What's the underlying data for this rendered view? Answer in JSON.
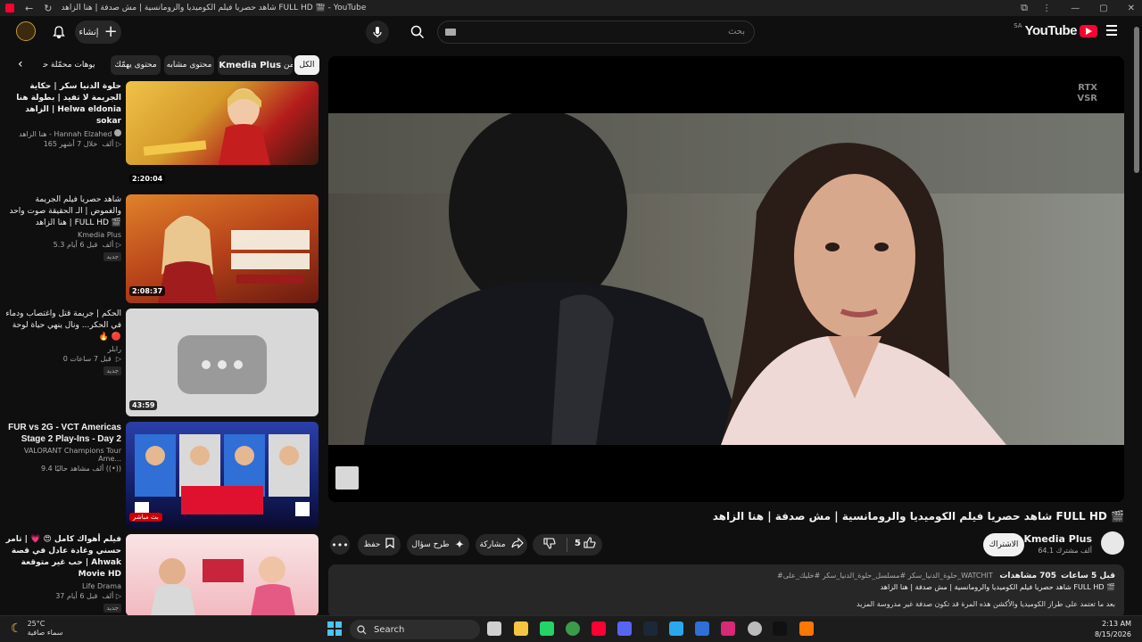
{
  "browser": {
    "tab_title": "شاهد حصريا فيلم الكوميديا والرومانسية | مش صدفة | هنا الزاهد FULL HD 🎬 - YouTube",
    "back_glyph": "←",
    "reload_glyph": "↻"
  },
  "header": {
    "logo_text": "YouTube",
    "country": "SA",
    "search_placeholder": "بحث",
    "create_label": "إنشاء",
    "create_glyph": "+"
  },
  "chips": [
    {
      "label": "الكل",
      "active": true
    },
    {
      "label": "من",
      "bold": "Kmedia Plus",
      "active": false
    },
    {
      "label": "محتوى مشابه",
      "active": false
    },
    {
      "label": "محتوى يهمّك",
      "active": false
    },
    {
      "label": "فيديوهات محمّلة حديثًا",
      "active": false
    }
  ],
  "related": [
    {
      "title": "حلوة الدنيا سكر | حكاية الجريمة لا تفيد | بطولة هنا الزاهد | Helwa eldonia sokar",
      "channel": "هنا الزاهد - Hannah Elzahed",
      "verified": true,
      "meta": "165 ألف ‏ خلال 7 أشهر",
      "duration": "2:20:04",
      "badge": "",
      "thumb_colors": [
        "#e9b740",
        "#b31c1c",
        "#2b1a10"
      ]
    },
    {
      "title": "شاهد حصريا فيلم الجريمة والغموض | الـ الحقيقة صوت واحد | هنا الزاهد FULL HD 🎬",
      "channel": "Kmedia Plus",
      "verified": false,
      "meta": "5.3 ألف ‏ قبل 6 أيام",
      "duration": "2:08:37",
      "badge": "جديد",
      "thumb_colors": [
        "#d96a1c",
        "#8a1e12",
        "#f2d7b0"
      ]
    },
    {
      "title": "الحكم | جريمة قتل واغتصاب ودماء في الحكر... ونال ينهي حياة لوحة 🔥 🔴",
      "channel": "رابلر",
      "verified": false,
      "meta": "0 ‏ قبل 7 ساعات",
      "duration": "43:59",
      "badge": "جديد",
      "thumb_colors": [
        "#dcdcdc",
        "#cfcfcf",
        "#bdbdbd"
      ]
    },
    {
      "title": "FUR vs 2G - VCT Americas Stage 2 Play-Ins - Day 2",
      "channel": "VALORANT Champions Tour Ame...",
      "verified": false,
      "meta": "9.4 ألف مشاهد حاليًا",
      "duration": "",
      "badge": "",
      "live": "بث مباشر",
      "thumb_colors": [
        "#1c2f8a",
        "#d01030",
        "#0b0b2e"
      ]
    },
    {
      "title": "فيلم أهواك كامل 😍 💗 | تامر حسني وغادة عادل في قصة حب غير متوقعة | Ahwak Movie HD",
      "channel": "Life Drama",
      "verified": false,
      "meta": "37 ألف ‏ قبل 6 أيام",
      "duration": "",
      "badge": "جديد",
      "thumb_colors": [
        "#f6d9d9",
        "#c82a3c",
        "#f0a5b0"
      ]
    }
  ],
  "player": {
    "rtx_line1": "RTX",
    "rtx_line2": "VSR"
  },
  "video": {
    "title": "شاهد حصريا فيلم الكوميديا والرومانسية | مش صدفة | هنا الزاهد FULL HD 🎬",
    "channel": "Kmedia Plus",
    "subscribers": "64.1 ألف مشترك",
    "subscribe_label": "الاشتراك",
    "likes": "5",
    "share_label": "مشاركة",
    "ask_label": "طرح سؤال",
    "save_label": "حفظ",
    "more_glyph": "•••"
  },
  "description": {
    "views": "705 مشاهدات",
    "age": "قبل 5 ساعات",
    "hashtags": "#حلوة_الدنيا_سكر #مسلسل_حلوة_الدنيا_سكر #خليك_على_WATCHIT",
    "line2": "شاهد حصريا فيلم الكوميديا والرومانسية | مش صدفة | هنا الزاهد FULL HD 🎬",
    "line3": "بعد ما تعتمد على طراز الكوميديا والأكشن هذه المرة قد تكون صدفة غير مدروسة المزيد"
  },
  "taskbar": {
    "temp": "25°C",
    "weather": "سماء صافية",
    "search_label": "Search",
    "time": "2:13 AM",
    "date": "8/15/2026"
  },
  "colors": {
    "youtube_red": "#ff0033",
    "background": "#0f0f0f",
    "surface": "#272727"
  }
}
